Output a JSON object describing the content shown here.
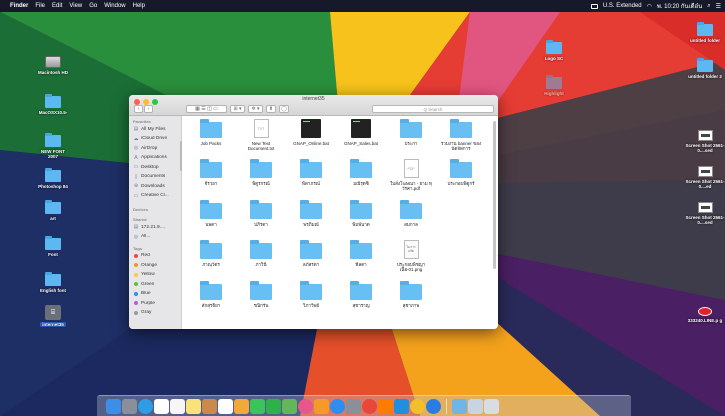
{
  "menubar": {
    "apple": "",
    "items": [
      "Finder",
      "File",
      "Edit",
      "View",
      "Go",
      "Window",
      "Help"
    ],
    "input_source": "U.S. Extended",
    "datetime": "พ. 10:20 กันเดือ๋น"
  },
  "desktop": {
    "left_icons": [
      {
        "label": "Macintosh HD",
        "type": "drive"
      },
      {
        "label": "MacOSX10.5-",
        "type": "folder"
      },
      {
        "label": "NEW FONT 2007",
        "type": "folder"
      },
      {
        "label": "Photoshop 84",
        "type": "folder"
      },
      {
        "label": "art",
        "type": "folder"
      },
      {
        "label": "Font",
        "type": "folder"
      },
      {
        "label": "English font",
        "type": "folder"
      },
      {
        "label": "internet35",
        "type": "dmg"
      }
    ],
    "mid_icons": [
      {
        "label": "Logo SC",
        "type": "folder"
      },
      {
        "label": "Highlight",
        "type": "folder"
      }
    ],
    "right_icons": [
      {
        "label": "untitled folder",
        "type": "folder"
      },
      {
        "label": "untitled folder 2",
        "type": "folder"
      },
      {
        "label": "Screen Shot 2561-0....sed",
        "type": "shot"
      },
      {
        "label": "Screen Shot 2561-0....ed",
        "type": "shot"
      },
      {
        "label": "Screen Shot 2561-0....sed",
        "type": "shot"
      },
      {
        "label": "333240.LINE.p g",
        "type": "line"
      }
    ]
  },
  "finder": {
    "title": "internet35",
    "search_placeholder": "Q Search",
    "toolbar": {
      "back": "‹",
      "forward": "›",
      "arrange": "⊞ ▾",
      "action": "✲ ▾",
      "share": "⬆",
      "tag": "◯"
    },
    "sidebar": {
      "favorites_header": "Favorites",
      "favorites": [
        {
          "label": "All My Files",
          "icon": "all-files-icon",
          "glyph": "▤"
        },
        {
          "label": "iCloud Drive",
          "icon": "cloud-icon",
          "glyph": "☁"
        },
        {
          "label": "AirDrop",
          "icon": "airdrop-icon",
          "glyph": "◎"
        },
        {
          "label": "Applications",
          "icon": "applications-icon",
          "glyph": "A"
        },
        {
          "label": "Desktop",
          "icon": "desktop-icon",
          "glyph": "▭"
        },
        {
          "label": "Documents",
          "icon": "documents-icon",
          "glyph": "▯"
        },
        {
          "label": "Downloads",
          "icon": "downloads-icon",
          "glyph": "⊕"
        },
        {
          "label": "Creative Cl...",
          "icon": "folder-icon",
          "glyph": "▭"
        }
      ],
      "devices_header": "Devices",
      "shared_header": "Shared",
      "shared": [
        {
          "label": "172.21.9....",
          "icon": "server-icon",
          "glyph": "▤"
        },
        {
          "label": "All...",
          "icon": "network-icon",
          "glyph": "◎"
        }
      ],
      "tags_header": "Tags",
      "tags": [
        {
          "label": "Red",
          "color": "#f2453d"
        },
        {
          "label": "Orange",
          "color": "#f7941d"
        },
        {
          "label": "Yellow",
          "color": "#f5d328"
        },
        {
          "label": "Green",
          "color": "#5ac13a"
        },
        {
          "label": "Blue",
          "color": "#2f8ef5"
        },
        {
          "label": "Purple",
          "color": "#b25fd6"
        },
        {
          "label": "Gray",
          "color": "#9a9a9a"
        }
      ]
    },
    "files": [
      [
        {
          "name": "Job Packs",
          "kind": "folder"
        },
        {
          "name": "New Text Document.txt",
          "kind": "txt",
          "thumb": "TXT"
        },
        {
          "name": "GNAP_Online.bat",
          "kind": "dark"
        },
        {
          "name": "GNAP_Sales.bat",
          "kind": "dark"
        },
        {
          "name": "ประกา",
          "kind": "folder"
        },
        {
          "name": "รวมงาน banner ของ นัดจัดการ",
          "kind": "folder"
        }
      ],
      [
        {
          "name": "จีรวยา",
          "kind": "folder"
        },
        {
          "name": "พิตูรกรณ์",
          "kind": "folder"
        },
        {
          "name": "พิดาภรณ์",
          "kind": "folder"
        },
        {
          "name": "มณีรุตซิ",
          "kind": "folder"
        },
        {
          "name": "ใบสั่งโฆษณา - ยาม ทุวัรคา.pdf",
          "kind": "pdf",
          "thumb": "PDF"
        },
        {
          "name": "ประกอบพิตูกร์",
          "kind": "folder"
        }
      ],
      [
        {
          "name": "นพดา",
          "kind": "folder"
        },
        {
          "name": "ปภิรดา",
          "kind": "folder"
        },
        {
          "name": "พรภิมณ์",
          "kind": "folder"
        },
        {
          "name": "พิมพ์นาต",
          "kind": "folder"
        },
        {
          "name": "สมกาล",
          "kind": "folder"
        }
      ],
      [
        {
          "name": "ภาณุวัตร",
          "kind": "folder"
        },
        {
          "name": "ภาวินี",
          "kind": "folder"
        },
        {
          "name": "ลภัสรดา",
          "kind": "folder"
        },
        {
          "name": "ฟีลดา",
          "kind": "folder"
        },
        {
          "name": "ประกอบพิชญา เนื้อ-01.png",
          "kind": "png",
          "thumb": "โอ การเเก๊ด"
        }
      ],
      [
        {
          "name": "สักสุรธิยา",
          "kind": "folder"
        },
        {
          "name": "รณิกรัน",
          "kind": "folder"
        },
        {
          "name": "วิภาวีพย์",
          "kind": "folder"
        },
        {
          "name": "สุชาราญ",
          "kind": "folder"
        },
        {
          "name": "สุชาภาพ",
          "kind": "folder"
        }
      ]
    ]
  },
  "dock": {
    "apps": [
      {
        "icon": "finder-icon",
        "color": "#3c8ee6"
      },
      {
        "icon": "launchpad-icon",
        "color": "#8a8f9c"
      },
      {
        "icon": "safari-icon",
        "color": "#2d9de6"
      },
      {
        "icon": "mail-icon",
        "color": "#ffffff"
      },
      {
        "icon": "calendar-icon",
        "color": "#f6f6f6"
      },
      {
        "icon": "notes-icon",
        "color": "#f9e27a"
      },
      {
        "icon": "contacts-icon",
        "color": "#c98a4c"
      },
      {
        "icon": "reminders-icon",
        "color": "#ffffff"
      },
      {
        "icon": "photos-icon",
        "color": "#f2a93b"
      },
      {
        "icon": "messages-icon",
        "color": "#3bc45a"
      },
      {
        "icon": "facetime-icon",
        "color": "#2fb14a"
      },
      {
        "icon": "maps-icon",
        "color": "#64b65b"
      },
      {
        "icon": "itunes-icon",
        "color": "#e7578a"
      },
      {
        "icon": "ibooks-icon",
        "color": "#f39a2b"
      },
      {
        "icon": "app-store-icon",
        "color": "#2e8df0"
      },
      {
        "icon": "system-preferences-icon",
        "color": "#8b8f97"
      },
      {
        "icon": "chrome-icon",
        "color": "#e9473a"
      },
      {
        "icon": "illustrator-icon",
        "color": "#ff7c00"
      },
      {
        "icon": "photoshop-icon",
        "color": "#1f8fe0"
      },
      {
        "icon": "chrome-2-icon",
        "color": "#f2c02d"
      },
      {
        "icon": "teamviewer-icon",
        "color": "#2a7de0"
      }
    ],
    "stacks": [
      {
        "icon": "downloads-stack-icon",
        "color": "#6fb5e8"
      },
      {
        "icon": "documents-stack-icon",
        "color": "#c9d4e2"
      },
      {
        "icon": "trash-icon",
        "color": "#d9dde3"
      }
    ]
  }
}
